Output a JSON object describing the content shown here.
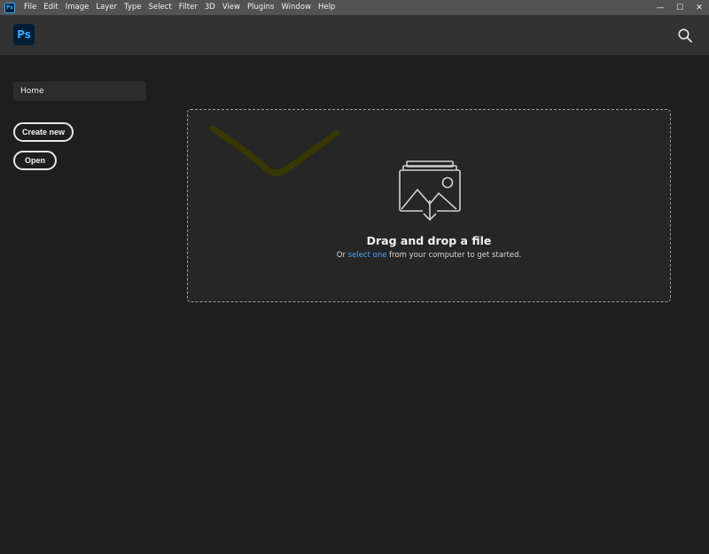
{
  "titlebar": {
    "app_icon_text": "Ps",
    "menu": [
      "File",
      "Edit",
      "Image",
      "Layer",
      "Type",
      "Select",
      "Filter",
      "3D",
      "View",
      "Plugins",
      "Window",
      "Help"
    ],
    "controls": {
      "minimize": "—",
      "maximize": "☐",
      "close": "✕"
    }
  },
  "header": {
    "logo_text": "Ps",
    "search_icon": "search-icon"
  },
  "sidebar": {
    "home_label": "Home",
    "create_new_label": "Create new",
    "open_label": "Open"
  },
  "dropzone": {
    "title": "Drag and drop a file",
    "sub_prefix": "Or ",
    "sub_link": "select one",
    "sub_suffix": " from your computer to get started.",
    "icon": "image-upload-icon"
  },
  "colors": {
    "accent": "#31a8ff",
    "link": "#4ea3f5",
    "scribble": "#3b3a00"
  }
}
